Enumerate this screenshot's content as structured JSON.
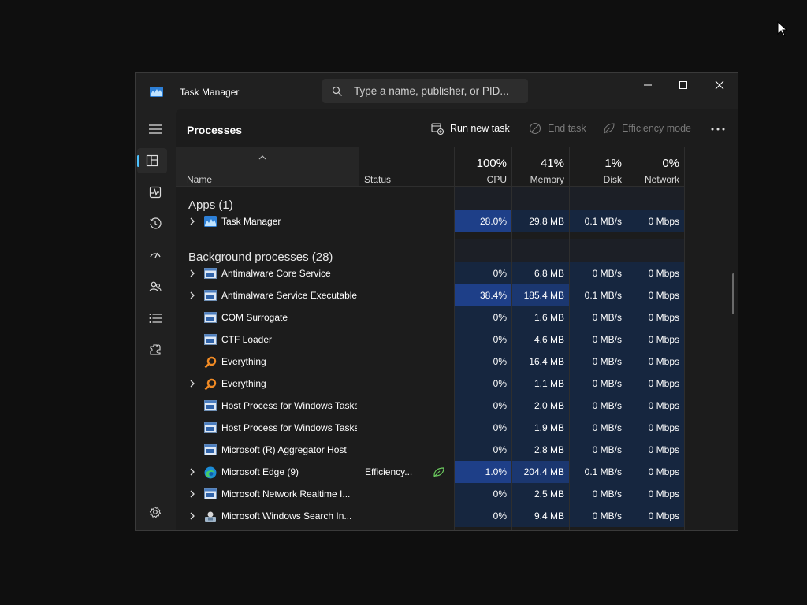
{
  "window": {
    "title": "Task Manager",
    "search_placeholder": "Type a name, publisher, or PID..."
  },
  "toolbar": {
    "page_title": "Processes",
    "run_new_task": "Run new task",
    "end_task": "End task",
    "efficiency_mode": "Efficiency mode"
  },
  "nav_items": [
    {
      "name": "processes",
      "icon": "processes-icon",
      "active": true
    },
    {
      "name": "performance",
      "icon": "performance-icon",
      "active": false
    },
    {
      "name": "app-history",
      "icon": "history-icon",
      "active": false
    },
    {
      "name": "startup-apps",
      "icon": "startup-icon",
      "active": false
    },
    {
      "name": "users",
      "icon": "users-icon",
      "active": false
    },
    {
      "name": "details",
      "icon": "details-icon",
      "active": false
    },
    {
      "name": "services",
      "icon": "services-icon",
      "active": false
    },
    {
      "name": "settings",
      "icon": "gear-icon",
      "active": false
    }
  ],
  "columns": {
    "name": "Name",
    "status": "Status",
    "cpu": {
      "pct": "100%",
      "label": "CPU"
    },
    "memory": {
      "pct": "41%",
      "label": "Memory"
    },
    "disk": {
      "pct": "1%",
      "label": "Disk"
    },
    "network": {
      "pct": "0%",
      "label": "Network"
    }
  },
  "groups": {
    "apps": "Apps (1)",
    "background": "Background processes (28)"
  },
  "colors": {
    "cell_low": "#16263f",
    "cell_mid": "#1b3770",
    "cell_high": "#1e3f88",
    "accent": "#4cc2ff"
  },
  "rows": [
    {
      "name": "Task Manager",
      "icon": "task-manager-icon",
      "expandable": true,
      "status": "",
      "efficiency": false,
      "cpu": "28.0%",
      "memory": "29.8 MB",
      "disk": "0.1 MB/s",
      "network": "0 Mbps",
      "cpu_level": "high",
      "mem_level": "low",
      "disk_level": "low",
      "net_level": "low"
    },
    {
      "name": "Antimalware Core Service",
      "icon": "service-window-icon",
      "expandable": true,
      "status": "",
      "efficiency": false,
      "cpu": "0%",
      "memory": "6.8 MB",
      "disk": "0 MB/s",
      "network": "0 Mbps",
      "cpu_level": "low",
      "mem_level": "low",
      "disk_level": "low",
      "net_level": "low"
    },
    {
      "name": "Antimalware Service Executable",
      "icon": "service-window-icon",
      "expandable": true,
      "status": "",
      "efficiency": false,
      "cpu": "38.4%",
      "memory": "185.4 MB",
      "disk": "0.1 MB/s",
      "network": "0 Mbps",
      "cpu_level": "high",
      "mem_level": "mid",
      "disk_level": "low",
      "net_level": "low"
    },
    {
      "name": "COM Surrogate",
      "icon": "service-window-icon",
      "expandable": false,
      "status": "",
      "efficiency": false,
      "cpu": "0%",
      "memory": "1.6 MB",
      "disk": "0 MB/s",
      "network": "0 Mbps",
      "cpu_level": "low",
      "mem_level": "low",
      "disk_level": "low",
      "net_level": "low"
    },
    {
      "name": "CTF Loader",
      "icon": "service-window-icon",
      "expandable": false,
      "status": "",
      "efficiency": false,
      "cpu": "0%",
      "memory": "4.6 MB",
      "disk": "0 MB/s",
      "network": "0 Mbps",
      "cpu_level": "low",
      "mem_level": "low",
      "disk_level": "low",
      "net_level": "low"
    },
    {
      "name": "Everything",
      "icon": "magnifier-orange-icon",
      "expandable": false,
      "status": "",
      "efficiency": false,
      "cpu": "0%",
      "memory": "16.4 MB",
      "disk": "0 MB/s",
      "network": "0 Mbps",
      "cpu_level": "low",
      "mem_level": "low",
      "disk_level": "low",
      "net_level": "low"
    },
    {
      "name": "Everything",
      "icon": "magnifier-orange-icon",
      "expandable": true,
      "status": "",
      "efficiency": false,
      "cpu": "0%",
      "memory": "1.1 MB",
      "disk": "0 MB/s",
      "network": "0 Mbps",
      "cpu_level": "low",
      "mem_level": "low",
      "disk_level": "low",
      "net_level": "low"
    },
    {
      "name": "Host Process for Windows Tasks",
      "icon": "service-window-icon",
      "expandable": false,
      "status": "",
      "efficiency": false,
      "cpu": "0%",
      "memory": "2.0 MB",
      "disk": "0 MB/s",
      "network": "0 Mbps",
      "cpu_level": "low",
      "mem_level": "low",
      "disk_level": "low",
      "net_level": "low"
    },
    {
      "name": "Host Process for Windows Tasks",
      "icon": "service-window-icon",
      "expandable": false,
      "status": "",
      "efficiency": false,
      "cpu": "0%",
      "memory": "1.9 MB",
      "disk": "0 MB/s",
      "network": "0 Mbps",
      "cpu_level": "low",
      "mem_level": "low",
      "disk_level": "low",
      "net_level": "low"
    },
    {
      "name": "Microsoft (R) Aggregator Host",
      "icon": "service-window-icon",
      "expandable": false,
      "status": "",
      "efficiency": false,
      "cpu": "0%",
      "memory": "2.8 MB",
      "disk": "0 MB/s",
      "network": "0 Mbps",
      "cpu_level": "low",
      "mem_level": "low",
      "disk_level": "low",
      "net_level": "low"
    },
    {
      "name": "Microsoft Edge (9)",
      "icon": "edge-icon",
      "expandable": true,
      "status": "Efficiency...",
      "efficiency": true,
      "cpu": "1.0%",
      "memory": "204.4 MB",
      "disk": "0.1 MB/s",
      "network": "0 Mbps",
      "cpu_level": "high",
      "mem_level": "mid",
      "disk_level": "low",
      "net_level": "low"
    },
    {
      "name": "Microsoft Network Realtime I...",
      "icon": "service-window-icon",
      "expandable": true,
      "status": "",
      "efficiency": false,
      "cpu": "0%",
      "memory": "2.5 MB",
      "disk": "0 MB/s",
      "network": "0 Mbps",
      "cpu_level": "low",
      "mem_level": "low",
      "disk_level": "low",
      "net_level": "low"
    },
    {
      "name": "Microsoft Windows Search In...",
      "icon": "search-indexer-icon",
      "expandable": true,
      "status": "",
      "efficiency": false,
      "cpu": "0%",
      "memory": "9.4 MB",
      "disk": "0 MB/s",
      "network": "0 Mbps",
      "cpu_level": "low",
      "mem_level": "low",
      "disk_level": "low",
      "net_level": "low"
    }
  ]
}
